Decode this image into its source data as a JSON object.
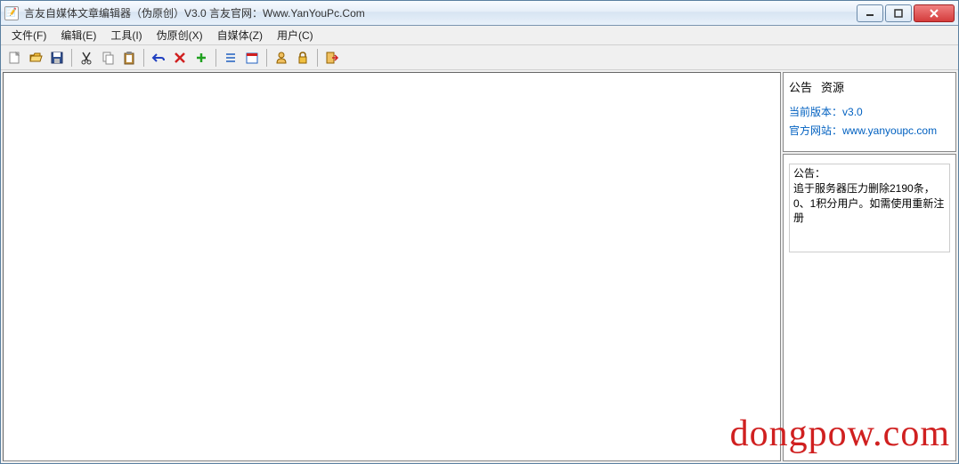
{
  "window": {
    "title": "言友自媒体文章编辑器（伪原创）V3.0 言友官网：Www.YanYouPc.Com"
  },
  "menu": {
    "file": "文件(F)",
    "edit": "编辑(E)",
    "tools": "工具(I)",
    "pseudo": "伪原创(X)",
    "media": "自媒体(Z)",
    "user": "用户(C)"
  },
  "sidebar": {
    "tab_announce": "公告",
    "tab_resource": "资源",
    "version_label": "当前版本：",
    "version_value": "v3.0",
    "site_label": "官方网站：",
    "site_value": "www.yanyoupc.com",
    "announce_title": "公告：",
    "announce_body": "追于服务器压力删除2190条，0、1积分用户。如需使用重新注册"
  },
  "watermark": "dongpow.com"
}
